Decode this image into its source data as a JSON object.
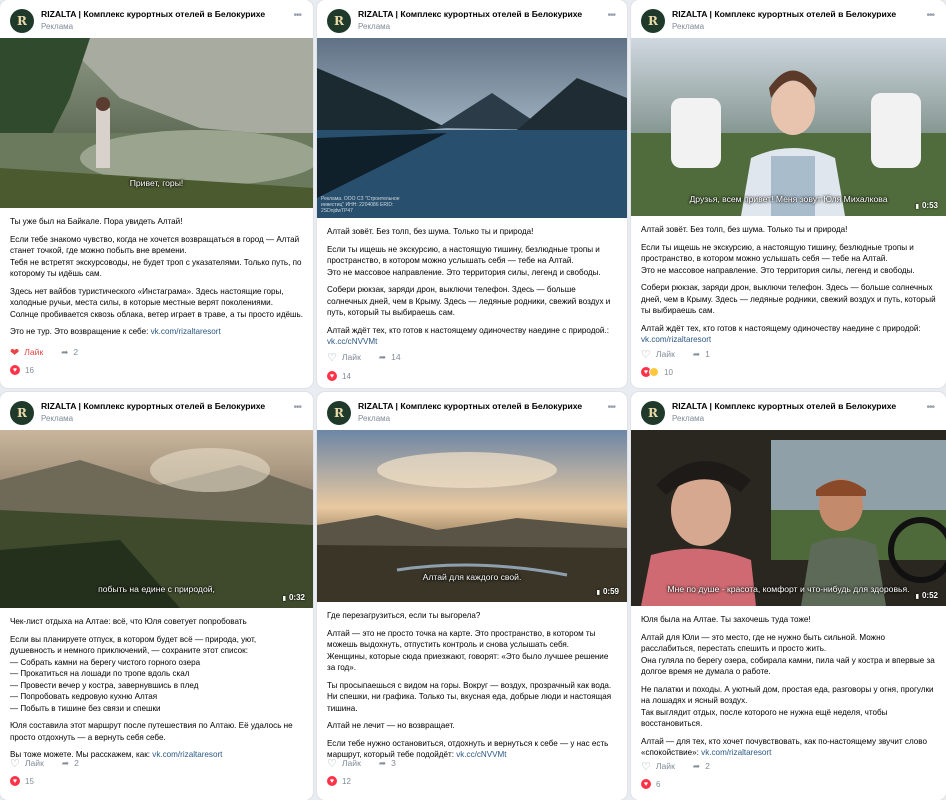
{
  "brand": {
    "name": "RIZALTA | Комплекс курортных отелей в Белокурихе",
    "sub": "Реклама",
    "logo": "R"
  },
  "posts": [
    {
      "caption": "Привет, горы!",
      "duration": "",
      "paras": [
        "Ты уже был на Байкале. Пора увидеть Алтай!",
        "Если тебе знакомо чувство, когда не хочется возвращаться в город — Алтай станет точкой, где можно побыть вне времени.\nТебя не встретят экскурсоводы, не будет троп с указателями. Только путь, по которому ты идёшь сам.",
        "Здесь нет вайбов туристического «Инстаграма». Здесь настоящие горы, холодные ручьи, места силы, в которые местные верят поколениями. Солнце пробивается сквозь облака, ветер играет в траве, а ты просто идёшь.",
        "Это не тур. Это возвращение к себе: "
      ],
      "link": "vk.com/rizaltaresort",
      "like_label": "Лайк",
      "shares": "2",
      "likes": "16"
    },
    {
      "caption": "",
      "duration": "",
      "watermark": "Реклама. ООО СЗ \"Строительное инвестиц\" ИНН: 2204086 ERID: 2SDnjdwTP47",
      "paras": [
        "Алтай зовёт. Без толп, без шума. Только ты и природа!",
        "Если ты ищешь не экскурсию, а настоящую тишину, безлюдные тропы и пространство, в котором можно услышать себя — тебе на Алтай.\nЭто не массовое направление. Это территория силы, легенд и свободы.",
        "Собери рюкзак, заряди дрон, выключи телефон. Здесь — больше солнечных дней, чем в Крыму. Здесь — ледяные родники, свежий воздух и путь, который ты выбираешь сам.",
        "Алтай ждёт тех, кто готов к настоящему одиночеству наедине с природой.: "
      ],
      "link": "vk.cc/cNVVMt",
      "like_label": "Лайк",
      "shares": "14",
      "likes": "14"
    },
    {
      "caption": "Друзья, всем привет! Меня зовут Юля Михалкова",
      "duration": "0:53",
      "paras": [
        "Алтай зовёт. Без толп, без шума. Только ты и природа!",
        "Если ты ищешь не экскурсию, а настоящую тишину, безлюдные тропы и пространство, в котором можно услышать себя — тебе на Алтай.\nЭто не массовое направление. Это территория силы, легенд и свободы.",
        "Собери рюкзак, заряди дрон, выключи телефон. Здесь — больше солнечных дней, чем в Крыму. Здесь — ледяные родники, свежий воздух и путь, который ты выбираешь сам.",
        "Алтай ждёт тех, кто готов к настоящему одиночеству наедине с природой: "
      ],
      "link": "vk.com/rizaltaresort",
      "like_label": "Лайк",
      "shares": "1",
      "likes": "10"
    },
    {
      "caption": "побыть на едине с природой,",
      "duration": "0:32",
      "paras": [
        "Чек-лист отдыха на Алтае: всё, что Юля советует попробовать",
        "Если вы планируете отпуск, в котором будет всё — природа, уют, душевность и немного приключений, — сохраните этот список:\n— Собрать камни на берегу чистого горного озера\n— Прокатиться на лошади по тропе вдоль скал\n— Провести вечер у костра, завернувшись в плед\n— Попробовать кедровую кухню Алтая\n— Побыть в тишине без связи и спешки",
        "Юля составила этот маршрут после путешествия по Алтаю. Её удалось не просто отдохнуть — а вернуть себя себе.",
        "Вы тоже можете. Мы расскажем, как: "
      ],
      "link": "vk.com/rizaltaresort",
      "like_label": "Лайк",
      "shares": "2",
      "likes": "15"
    },
    {
      "caption": "Алтай для каждого свой.",
      "duration": "0:59",
      "paras": [
        "Где перезагрузиться, если ты выгорела?",
        "Алтай — это не просто точка на карте. Это пространство, в котором ты можешь выдохнуть, отпустить контроль и снова услышать себя.\nЖенщины, которые сюда приезжают, говорят: «Это было лучшее решение за год».",
        "Ты просыпаешься с видом на горы. Вокруг — воздух, прозрачный как вода. Ни спешки, ни графика. Только ты, вкусная еда, добрые люди и настоящая тишина.",
        "Алтай не лечит — но возвращает.",
        "Если тебе нужно остановиться, отдохнуть и вернуться к себе — у нас есть маршрут, который тебе подойдёт: "
      ],
      "link": "vk.cc/cNVVMt",
      "like_label": "Лайк",
      "shares": "3",
      "likes": "12"
    },
    {
      "caption": "Мне по душе - красота, комфорт и что-нибудь для здоровья.",
      "duration": "0:52",
      "paras": [
        "Юля была на Алтае. Ты захочешь туда тоже!",
        "Алтай для Юли — это место, где не нужно быть сильной. Можно расслабиться, перестать спешить и просто жить.\nОна гуляла по берегу озера, собирала камни, пила чай у костра и впервые за долгое время не думала о работе.",
        "Не палатки и походы. А уютный дом, простая еда, разговоры у огня, прогулки на лошадях и ясный воздух.\nТак выглядит отдых, после которого не нужна ещё неделя, чтобы восстановиться.",
        "Алтай — для тех, кто хочет почувствовать, как по-настоящему звучит слово «спокойствие»: "
      ],
      "link": "vk.com/rizaltaresort",
      "like_label": "Лайк",
      "shares": "2",
      "likes": "6"
    }
  ]
}
